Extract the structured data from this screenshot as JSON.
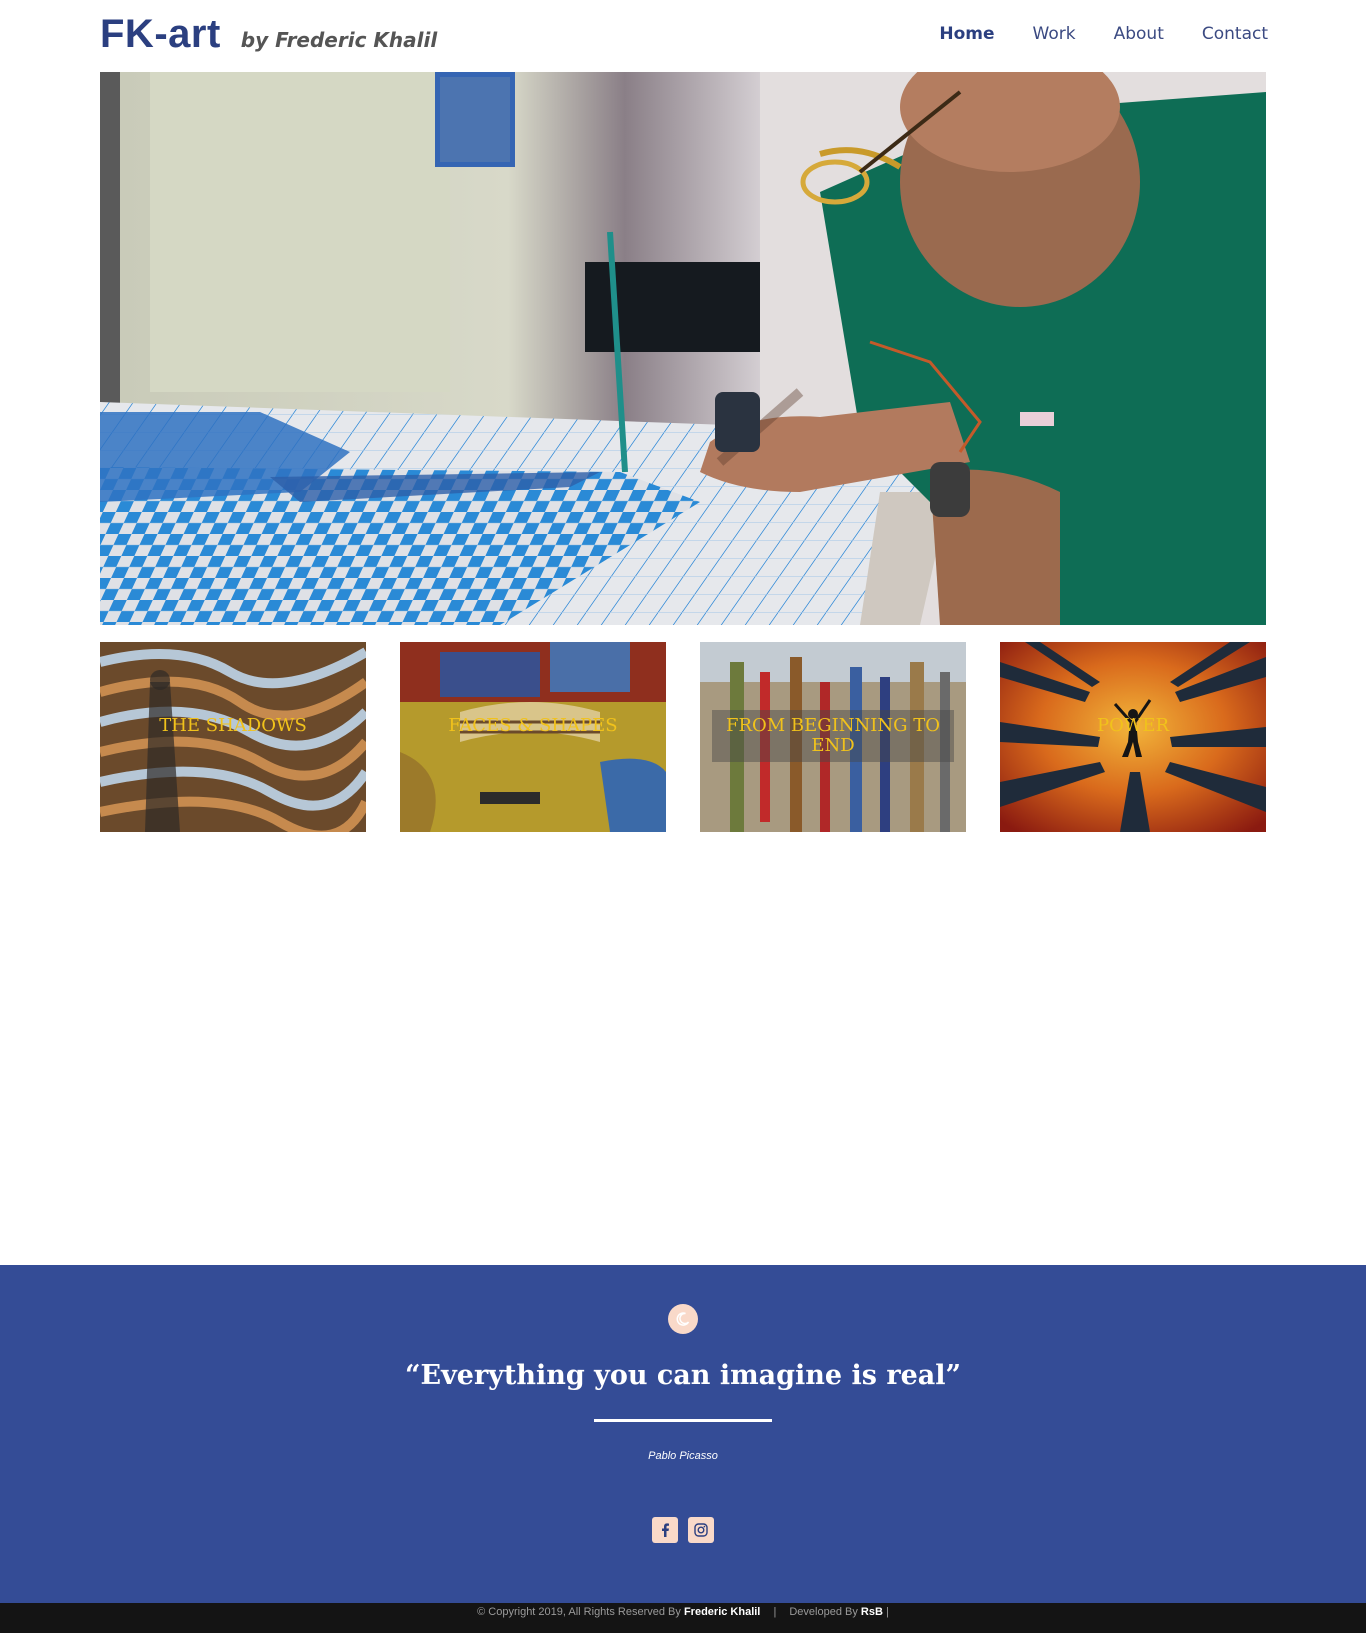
{
  "header": {
    "logo_main": "FK-art",
    "logo_sub": "by Frederic Khalil",
    "nav": [
      "Home",
      "Work",
      "About",
      "Contact"
    ],
    "active_nav": "Home"
  },
  "hero": {
    "image": "artist-painting-photo"
  },
  "gallery": {
    "tiles": [
      {
        "title": "THE SHADOWS"
      },
      {
        "title": "FACES & SHAPES"
      },
      {
        "title": "FROM BEGINNING TO END"
      },
      {
        "title": "POWER"
      }
    ]
  },
  "footer": {
    "badge_icon": "moon-icon",
    "quote": "“Everything you can imagine is real”",
    "author": "Pablo Picasso",
    "socials": [
      "facebook-icon",
      "instagram-icon"
    ],
    "copyright_prefix": "© Copyright 2019, All Rights Reserved By",
    "copyright_owner": "Frederic Khalil",
    "developed_prefix": "Developed By",
    "developer": "RsB",
    "trailing_sep": "|"
  },
  "colors": {
    "brand": "#2b3f80",
    "footer_bg": "#344c96",
    "tile_title": "#f1c21b",
    "badge": "#f9d9c9"
  }
}
